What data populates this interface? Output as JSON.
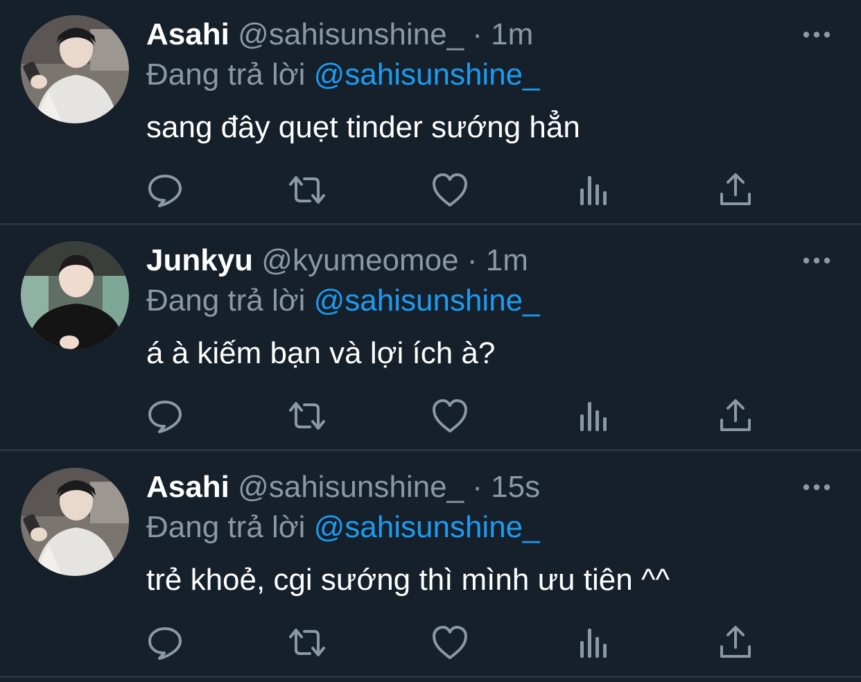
{
  "colors": {
    "background": "#16202b",
    "divider": "#2a3440",
    "secondary_text": "#8b98a5",
    "mention": "#1d9bf0",
    "primary_text": "#ffffff"
  },
  "tweets": [
    {
      "name": "Asahi",
      "handle": "@sahisunshine_",
      "separator": "·",
      "time": "1m",
      "reply_prefix": "Đang trả lời",
      "reply_to": "@sahisunshine_",
      "text": "sang đây quẹt tinder sướng hẳn",
      "avatar_icon": "profile-photo-asahi"
    },
    {
      "name": "Junkyu",
      "handle": "@kyumeomoe",
      "separator": "·",
      "time": "1m",
      "reply_prefix": "Đang trả lời",
      "reply_to": "@sahisunshine_",
      "text": "á à kiếm bạn và lợi ích à?",
      "avatar_icon": "profile-photo-junkyu"
    },
    {
      "name": "Asahi",
      "handle": "@sahisunshine_",
      "separator": "·",
      "time": "15s",
      "reply_prefix": "Đang trả lời",
      "reply_to": "@sahisunshine_",
      "text": "trẻ khoẻ, cgi sướng thì mình ưu tiên ^^",
      "avatar_icon": "profile-photo-asahi"
    }
  ],
  "action_icons": [
    "reply-icon",
    "retweet-icon",
    "like-icon",
    "analytics-icon",
    "share-icon"
  ],
  "more_icon": "more-options-icon"
}
